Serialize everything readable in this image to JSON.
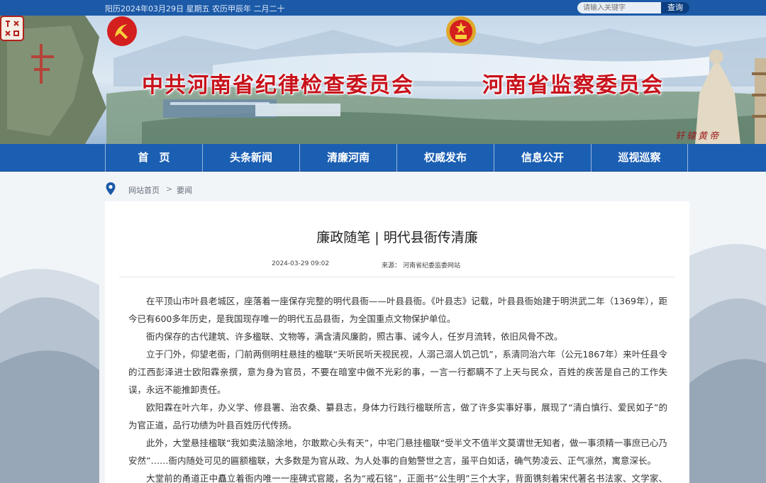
{
  "topbar": {
    "date": "阳历2024年03月29日 星期五 农历甲辰年 二月二十",
    "search_placeholder": "请输入关键字",
    "search_button": "查询"
  },
  "header": {
    "title_left": "中共河南省纪律检查委员会",
    "title_right": "河南省监察委员会",
    "calligraphy": "轩辕黄帝",
    "seal": "拜祖大典"
  },
  "nav": {
    "items": [
      {
        "label": "首　页"
      },
      {
        "label": "头条新闻"
      },
      {
        "label": "清廉河南"
      },
      {
        "label": "权威发布"
      },
      {
        "label": "信息公开"
      },
      {
        "label": "巡视巡察"
      }
    ]
  },
  "breadcrumb": {
    "home": "网站首页",
    "separator": ">",
    "current": "要闻"
  },
  "article": {
    "title": "廉政随笔 | 明代县衙传清廉",
    "date": "2024-03-29 09:02",
    "source_label": "来源：",
    "source": "河南省纪委监委网站",
    "paragraphs": [
      "在平顶山市叶县老城区，座落着一座保存完整的明代县衙——叶县县衙。《叶县志》记载，叶县县衙始建于明洪武二年（1369年），距今已有600多年历史，是我国现存唯一的明代五品县衙，为全国重点文物保护单位。",
      "衙内保存的古代建筑、许多楹联、文物等，满含清风廉韵，照古事、诫今人，任岁月流转，依旧风骨不改。",
      "立于门外，仰望老衙，门前两侧明柱悬挂的楹联“天听民听天视民视，人溺己溺人饥己饥”，系清同治六年（公元1867年）来叶任县令的江西彭泽进士欧阳霖亲撰，意为身为官员，不要在暗室中做不光彩的事，一言一行都瞒不了上天与民众，百姓的疾苦是自己的工作失误，永远不能推卸责任。",
      "欧阳霖在叶六年，办义学、修县署、治农桑、纂县志，身体力行践行楹联所言，做了许多实事好事，展现了“清白慎行、爱民如子”的为官正道，品行功绩为叶县百姓历代传扬。",
      "此外，大堂悬挂楹联“我如卖法脑涂地，尔敢欺心头有天”，中宅门悬挂楹联“受半文不值半文莫谓世无知者，做一事须精一事庶已心乃安然”……衙内随处可见的匾额楹联，大多数是为官从政、为人处事的自勉警世之言，虽平白如话，确气势凌云、正气凛然，寓意深长。",
      "大堂前的甬道正中矗立着衙内唯一一座碑式官箴，名为“戒石铭”，正面书“公生明”三个大字，背面镌刻着宋代著名书法家、文学家、曾"
    ]
  },
  "colors": {
    "topbar": "#1c5aa8",
    "nav": "#1b5fb3",
    "title_red": "#c8121c"
  }
}
